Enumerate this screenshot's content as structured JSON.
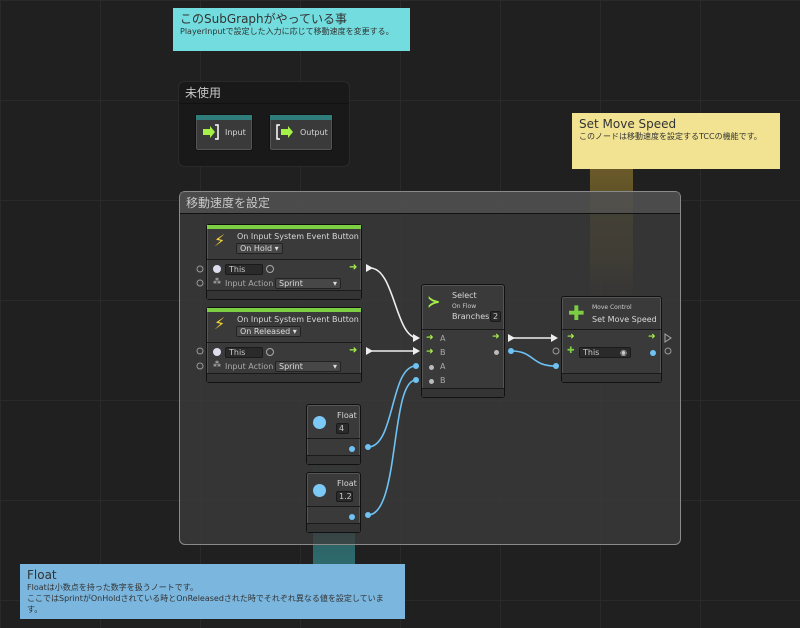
{
  "notes": {
    "subgraph": {
      "title": "このSubGraphがやっている事",
      "body": "PlayerInputで設定した入力に応じて移動速度を変更する。",
      "color": "#72dcde"
    },
    "move_speed": {
      "title": "Set Move Speed",
      "body": "このノードは移動速度を設定するTCCの機能です。",
      "color": "#f1e391"
    },
    "float": {
      "title": "Float",
      "body1": "Floatは小数点を持った数字を扱うノートです。",
      "body2": "ここではSprintがOnHoldされている時とOnReleasedされた時でそれぞれ異なる値を設定しています。",
      "color": "#7ab6de"
    }
  },
  "groups": {
    "unused": {
      "title": "未使用"
    },
    "set_speed": {
      "title": "移動速度を設定"
    }
  },
  "io_nodes": {
    "input": "Input",
    "output": "Output"
  },
  "event_nodes": [
    {
      "title": "On Input System Event Button",
      "mode": "On Hold",
      "target": "This",
      "action_label": "Input Action",
      "action": "Sprint"
    },
    {
      "title": "On Input System Event Button",
      "mode": "On Released",
      "target": "This",
      "action_label": "Input Action",
      "action": "Sprint"
    }
  ],
  "select_node": {
    "title": "Select",
    "subtitle": "On Flow",
    "branches_label": "Branches",
    "branches": "2",
    "ports": [
      "A",
      "B",
      "A",
      "B"
    ]
  },
  "move_node": {
    "category": "Move Control",
    "title": "Set Move Speed",
    "target": "This"
  },
  "float_nodes": [
    {
      "title": "Float",
      "value": "4"
    },
    {
      "title": "Float",
      "value": "1.2"
    }
  ],
  "colors": {
    "flow": "#a6f04a",
    "value": "#6ec3f4",
    "event_bar": "#7ccf43",
    "io_bar": "#2f7d7a"
  }
}
